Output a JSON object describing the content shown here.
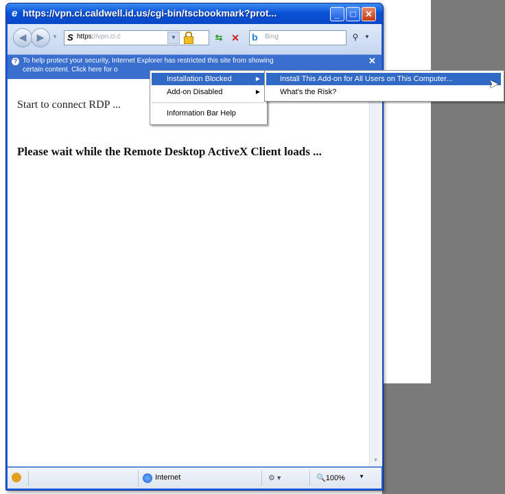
{
  "window": {
    "title": "https://vpn.ci.caldwell.id.us/cgi-bin/tscbookmark?prot...",
    "ie_icon": "e",
    "minimize": "_",
    "maximize": "□",
    "close": "✕"
  },
  "toolbar": {
    "address_prefix": "https:",
    "address_rest": "//vpn.ci.c",
    "address_icon": "S",
    "search_placeholder": "Bing",
    "search_icon": "search-icon",
    "back_icon": "back-arrow-icon",
    "forward_icon": "forward-arrow-icon",
    "refresh_symbol": "⇆",
    "stop_symbol": "✕"
  },
  "infobar": {
    "line1": "To help protect your security, Internet Explorer has restricted this site from showing",
    "line2": "certain content. Click here for o",
    "close": "✕"
  },
  "context_menu": {
    "items": [
      {
        "label": "Installation Blocked",
        "highlighted": true,
        "submenu": true
      },
      {
        "label": "Add-on Disabled",
        "highlighted": false,
        "submenu": true
      },
      {
        "label": "Information Bar Help",
        "highlighted": false,
        "submenu": false
      }
    ]
  },
  "submenu": {
    "items": [
      {
        "label": "Install This Add-on for All Users on This Computer...",
        "highlighted": true
      },
      {
        "label": "What's the Risk?",
        "highlighted": false
      }
    ]
  },
  "content": {
    "status_text": "Start to connect RDP ...",
    "loading_text": "Please wait while the Remote Desktop ActiveX Client loads ..."
  },
  "statusbar": {
    "zone": "Internet",
    "zoom": "100%"
  },
  "colors": {
    "title_blue": "#0a52d8",
    "infobar_blue": "#3a6fd0",
    "menu_highlight": "#3169c6"
  }
}
